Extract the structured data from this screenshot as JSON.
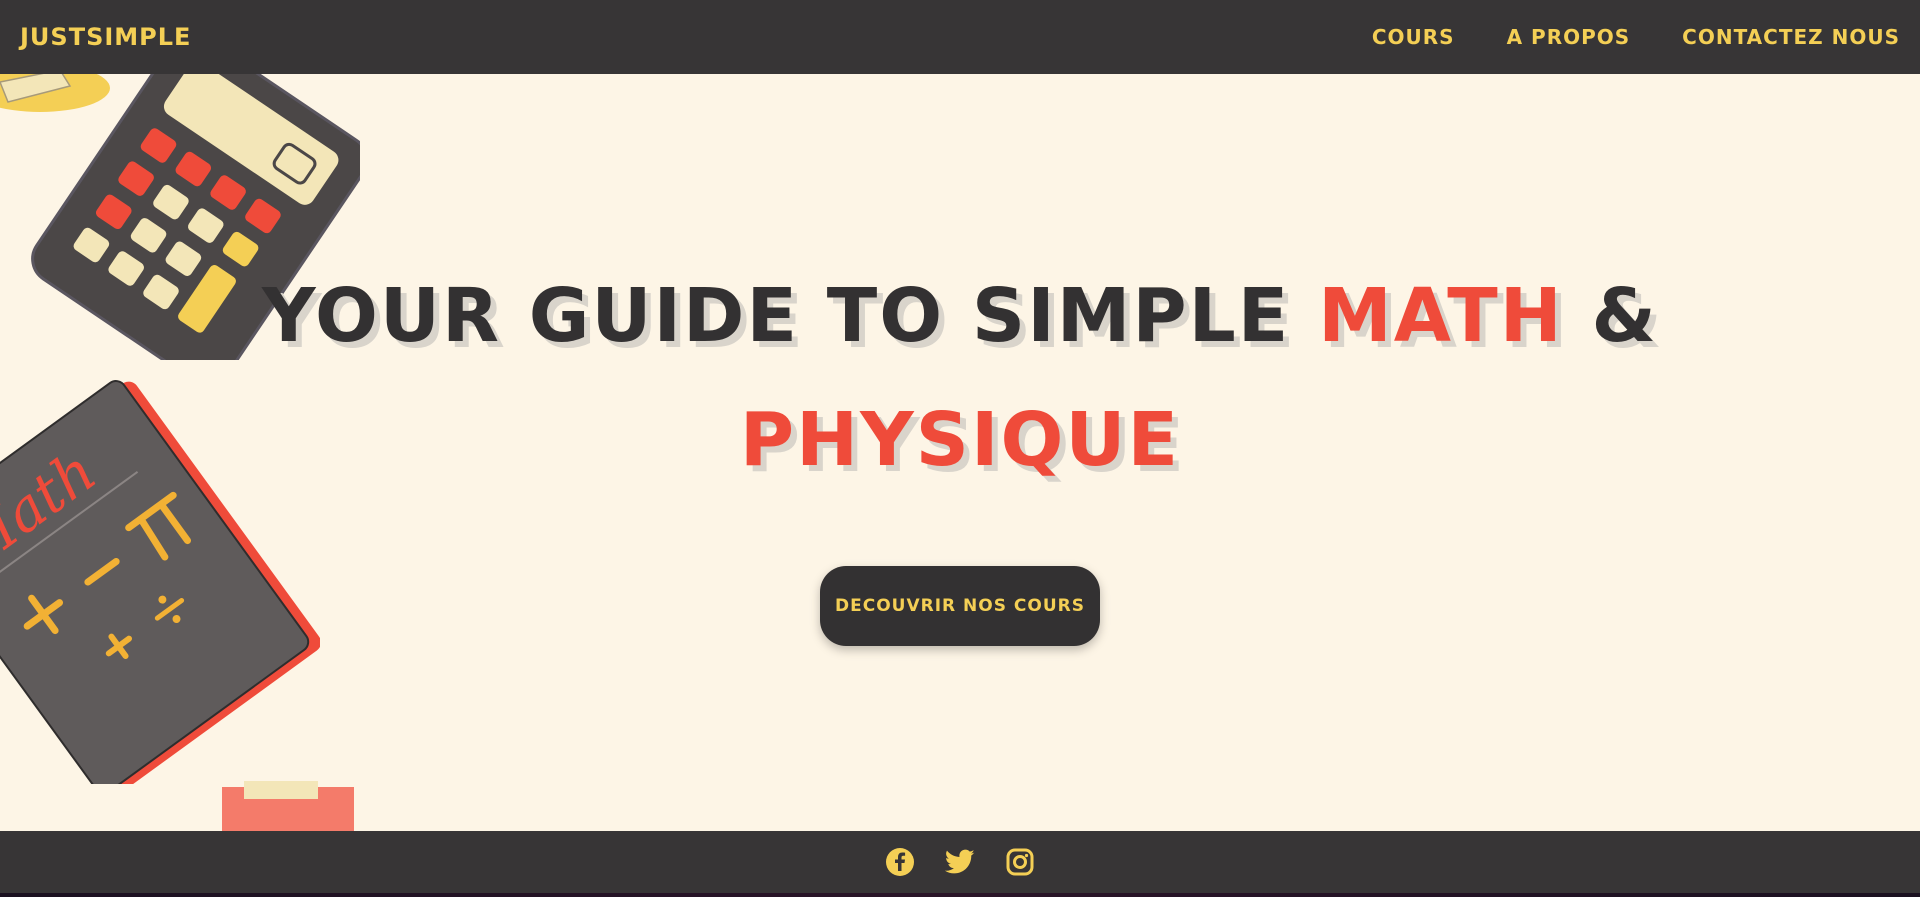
{
  "nav": {
    "brand": "JUSTSIMPLE",
    "links": [
      "COURS",
      "A PROPOS",
      "CONTACTEZ NOUS"
    ]
  },
  "hero": {
    "headline_part1": "YOUR GUIDE TO SIMPLE ",
    "headline_accent": "MATH",
    "headline_part2": " &",
    "headline_line2": "PHYSIQUE",
    "cta_label": "DECOUVRIR NOS COURS"
  },
  "book": {
    "title": "Math"
  },
  "footer": {
    "icons": [
      "facebook-icon",
      "twitter-icon",
      "instagram-icon"
    ]
  },
  "colors": {
    "dark": "#373536",
    "yellow": "#f4cf55",
    "red": "#ef4b3a",
    "cream": "#fdf5e6"
  }
}
